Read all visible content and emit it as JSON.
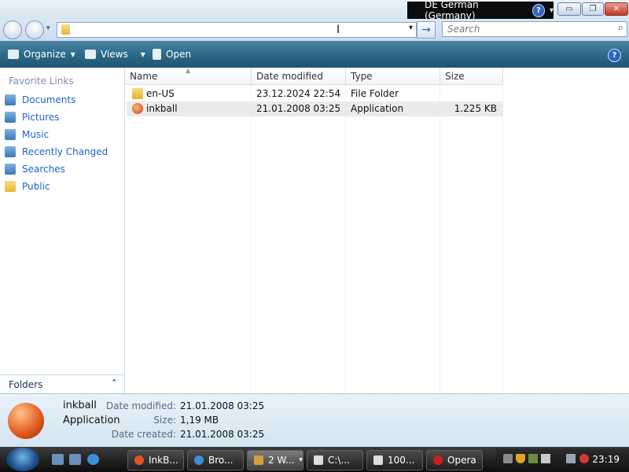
{
  "window": {
    "language_label": "DE German (Germany)",
    "help_mark": "?",
    "minimize_glyph": "▭",
    "maximize_glyph": "❐",
    "close_glyph": "✕"
  },
  "address": {
    "value": "",
    "go_glyph": "→",
    "dropdown_glyph": "▾"
  },
  "search": {
    "placeholder": "Search",
    "icon": "search-icon",
    "glyph": "⌕"
  },
  "toolbar": {
    "organize": "Organize",
    "views": "Views",
    "open": "Open",
    "dropdown_glyph": "▾",
    "help_mark": "?"
  },
  "nav": {
    "header": "Favorite Links",
    "items": [
      {
        "label": "Documents",
        "icon": "documents-icon"
      },
      {
        "label": "Pictures",
        "icon": "pictures-icon"
      },
      {
        "label": "Music",
        "icon": "music-icon"
      },
      {
        "label": "Recently Changed",
        "icon": "recently-changed-icon"
      },
      {
        "label": "Searches",
        "icon": "searches-icon"
      },
      {
        "label": "Public",
        "icon": "folder-icon"
      }
    ],
    "folders_label": "Folders",
    "folders_chevron": "⌃"
  },
  "list": {
    "columns": [
      "Name",
      "Date modified",
      "Type",
      "Size"
    ],
    "rows": [
      {
        "name": "en-US",
        "date": "23.12.2024 22:54",
        "type": "File Folder",
        "size": ""
      },
      {
        "name": "inkball",
        "date": "21.01.2008 03:25",
        "type": "Application",
        "size": "1.225 KB"
      }
    ]
  },
  "details": {
    "name": "inkball",
    "type": "Application",
    "labels": [
      "Date modified:",
      "Size:",
      "Date created:"
    ],
    "values": [
      "21.01.2008 03:25",
      "1,19 MB",
      "21.01.2008 03:25"
    ]
  },
  "taskbar": {
    "tasks": [
      "InkB...",
      "Bro...",
      "2 W...",
      "C:\\...",
      "100...",
      "Opera"
    ],
    "clock": "23:19"
  }
}
